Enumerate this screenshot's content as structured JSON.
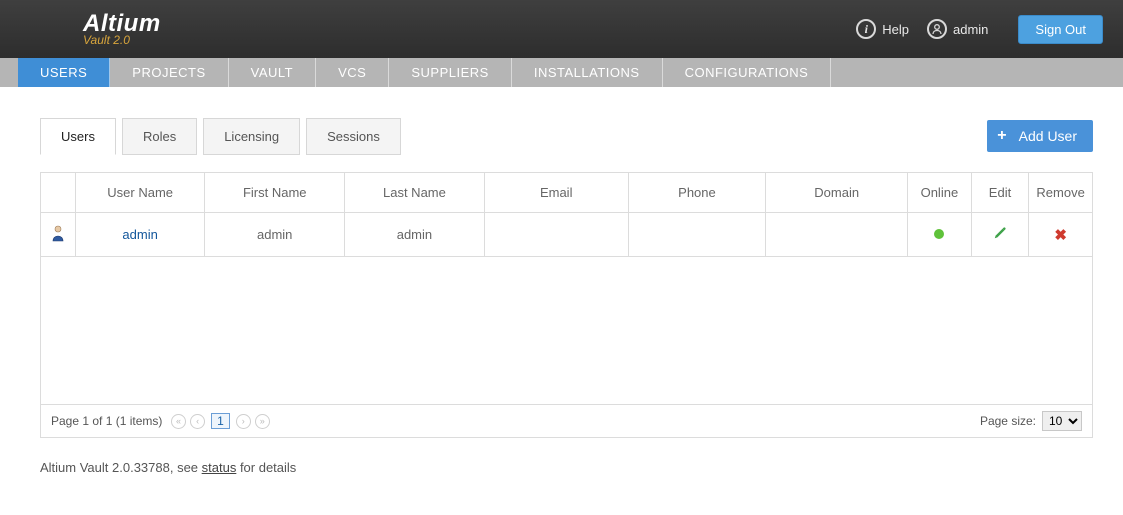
{
  "topbar": {
    "brand_main": "Altium",
    "brand_sub": "Vault 2.0",
    "help_label": "Help",
    "user_label": "admin",
    "signout_label": "Sign Out"
  },
  "mainnav": {
    "items": [
      {
        "label": "USERS",
        "active": true
      },
      {
        "label": "PROJECTS"
      },
      {
        "label": "VAULT"
      },
      {
        "label": "VCS"
      },
      {
        "label": "SUPPLIERS"
      },
      {
        "label": "INSTALLATIONS"
      },
      {
        "label": "CONFIGURATIONS"
      }
    ]
  },
  "subtabs": {
    "items": [
      {
        "label": "Users",
        "active": true
      },
      {
        "label": "Roles"
      },
      {
        "label": "Licensing"
      },
      {
        "label": "Sessions"
      }
    ]
  },
  "add_button_label": "Add User",
  "grid": {
    "headers": {
      "username": "User Name",
      "firstname": "First Name",
      "lastname": "Last Name",
      "email": "Email",
      "phone": "Phone",
      "domain": "Domain",
      "online": "Online",
      "edit": "Edit",
      "remove": "Remove"
    },
    "rows": [
      {
        "username": "admin",
        "firstname": "admin",
        "lastname": "admin",
        "email": "",
        "phone": "",
        "domain": "",
        "online": true
      }
    ]
  },
  "pager": {
    "summary": "Page 1 of 1 (1 items)",
    "current_page": "1",
    "page_size_label": "Page size:",
    "page_size_value": "10"
  },
  "footer": {
    "prefix": "Altium Vault 2.0.33788, see ",
    "status_link": "status",
    "suffix": " for details"
  }
}
